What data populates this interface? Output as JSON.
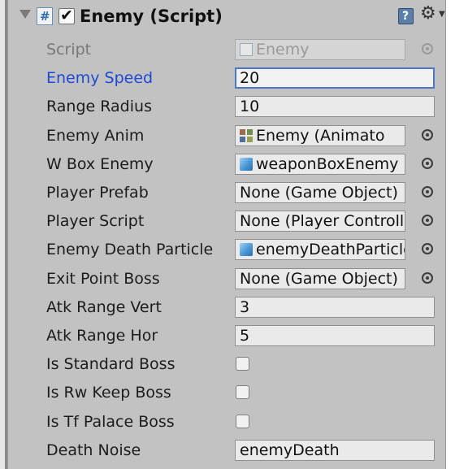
{
  "component": {
    "title": "Enemy (Script)",
    "enabled": true,
    "icons": {
      "component": "csharp-script-icon",
      "help": "help-book-icon",
      "settings": "gear-icon"
    }
  },
  "fields": [
    {
      "label": "Script",
      "value": "Enemy",
      "kind": "object",
      "icon": "script-icon",
      "state": "disabled"
    },
    {
      "label": "Enemy Speed",
      "value": "20",
      "kind": "number",
      "state": "focused"
    },
    {
      "label": "Range Radius",
      "value": "10",
      "kind": "number"
    },
    {
      "label": "Enemy Anim",
      "value": "Enemy (Animato",
      "kind": "object",
      "icon": "animator-icon"
    },
    {
      "label": "W Box Enemy",
      "value": "weaponBoxEnemy",
      "kind": "object",
      "icon": "prefab-icon"
    },
    {
      "label": "Player Prefab",
      "value": "None (Game Object)",
      "kind": "object"
    },
    {
      "label": "Player Script",
      "value": "None (Player Controller)",
      "kind": "object"
    },
    {
      "label": "Enemy Death Particle",
      "value": "enemyDeathParticle",
      "kind": "object",
      "icon": "prefab-icon"
    },
    {
      "label": "Exit Point Boss",
      "value": "None (Game Object)",
      "kind": "object"
    },
    {
      "label": "Atk Range Vert",
      "value": "3",
      "kind": "number"
    },
    {
      "label": "Atk Range Hor",
      "value": "5",
      "kind": "number"
    },
    {
      "label": "Is Standard Boss",
      "value": false,
      "kind": "bool"
    },
    {
      "label": "Is Rw Keep Boss",
      "value": false,
      "kind": "bool"
    },
    {
      "label": "Is Tf Palace Boss",
      "value": false,
      "kind": "bool"
    },
    {
      "label": "Death Noise",
      "value": "enemyDeath",
      "kind": "text"
    }
  ],
  "colors": {
    "panel": "#c2c2c2",
    "focused_label": "#1d49d6",
    "focused_border": "#4a76c8"
  }
}
